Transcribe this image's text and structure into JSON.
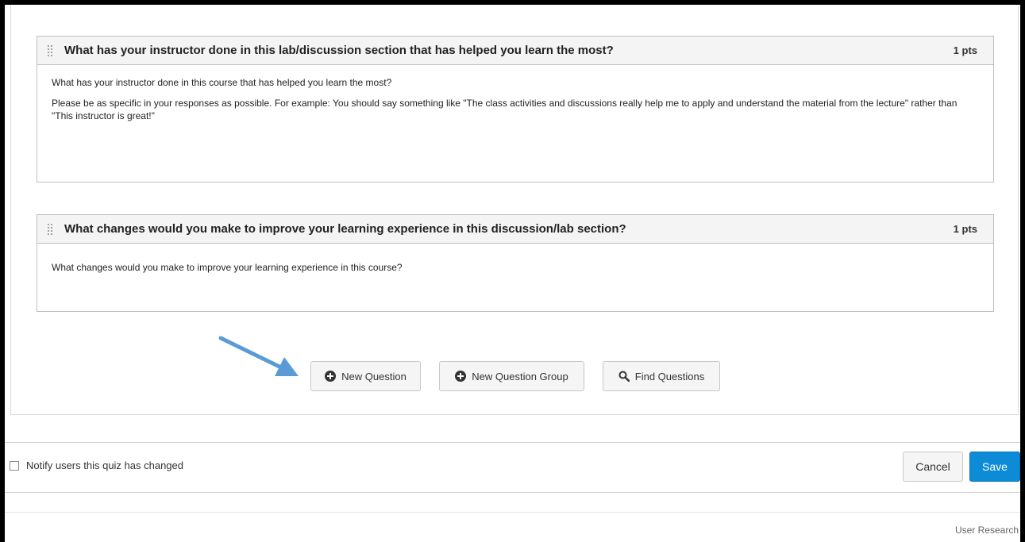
{
  "questions": [
    {
      "title": "What has your instructor done in this lab/discussion section that has helped you learn the most?",
      "points": "1 pts",
      "paragraphs": [
        "What has your instructor done in this course that has helped you learn the most?",
        "Please be as specific in your responses as possible. For example: You should say something like \"The class activities and discussions really help me to apply and understand the material from the lecture\" rather than \"This instructor is great!\""
      ]
    },
    {
      "title": "What changes would you make to improve your learning experience in this discussion/lab section?",
      "points": "1 pts",
      "paragraphs": [
        "What changes would you make to improve your learning experience in this course?"
      ]
    }
  ],
  "actions": {
    "new_question": "New Question",
    "new_question_group": "New Question Group",
    "find_questions": "Find Questions"
  },
  "footer": {
    "notify_label": "Notify users this quiz has changed",
    "notify_checked": false,
    "cancel_label": "Cancel",
    "save_label": "Save"
  },
  "watermark": "User Research",
  "colors": {
    "save_button": "#0e8bd6",
    "annotation_arrow": "#5b9bd5"
  },
  "icons": {
    "drag": "drag-handle-icon",
    "plus": "plus-circle-icon",
    "search": "search-icon",
    "arrow": "annotation-arrow-icon"
  }
}
